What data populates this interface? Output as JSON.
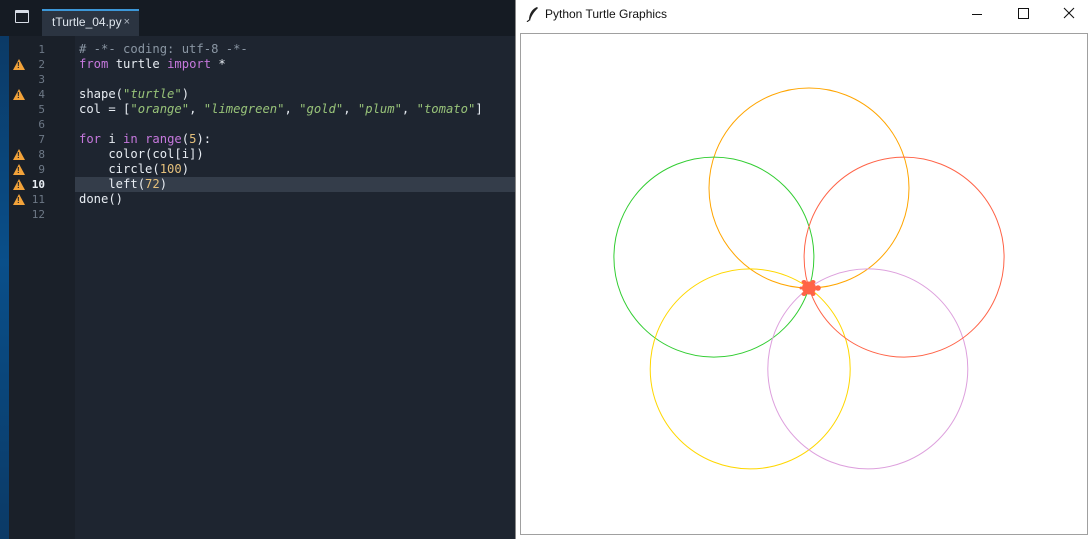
{
  "editor": {
    "tab": {
      "label": "tTurtle_04.py",
      "close": "×"
    },
    "active_line": 10,
    "lines": [
      {
        "num": "1",
        "warn": false,
        "tokens": [
          {
            "t": "# -*- coding: utf-8 -*-",
            "c": "comment"
          }
        ]
      },
      {
        "num": "2",
        "warn": true,
        "tokens": [
          {
            "t": "from",
            "c": "kw"
          },
          {
            "t": " turtle ",
            "c": "def"
          },
          {
            "t": "import",
            "c": "kw"
          },
          {
            "t": " *",
            "c": "def"
          }
        ]
      },
      {
        "num": "3",
        "warn": false,
        "tokens": []
      },
      {
        "num": "4",
        "warn": true,
        "tokens": [
          {
            "t": "shape(",
            "c": "def"
          },
          {
            "t": "\"turtle\"",
            "c": "str"
          },
          {
            "t": ")",
            "c": "def"
          }
        ]
      },
      {
        "num": "5",
        "warn": false,
        "tokens": [
          {
            "t": "col = [",
            "c": "def"
          },
          {
            "t": "\"orange\"",
            "c": "str"
          },
          {
            "t": ", ",
            "c": "def"
          },
          {
            "t": "\"limegreen\"",
            "c": "str"
          },
          {
            "t": ", ",
            "c": "def"
          },
          {
            "t": "\"gold\"",
            "c": "str"
          },
          {
            "t": ", ",
            "c": "def"
          },
          {
            "t": "\"plum\"",
            "c": "str"
          },
          {
            "t": ", ",
            "c": "def"
          },
          {
            "t": "\"tomato\"",
            "c": "str"
          },
          {
            "t": "]",
            "c": "def"
          }
        ]
      },
      {
        "num": "6",
        "warn": false,
        "tokens": []
      },
      {
        "num": "7",
        "warn": false,
        "tokens": [
          {
            "t": "for",
            "c": "kw"
          },
          {
            "t": " i ",
            "c": "def"
          },
          {
            "t": "in",
            "c": "kw"
          },
          {
            "t": " ",
            "c": "def"
          },
          {
            "t": "range",
            "c": "kw"
          },
          {
            "t": "(",
            "c": "def"
          },
          {
            "t": "5",
            "c": "num"
          },
          {
            "t": "):",
            "c": "def"
          }
        ]
      },
      {
        "num": "8",
        "warn": true,
        "tokens": [
          {
            "t": "    color(col[i])",
            "c": "def"
          }
        ]
      },
      {
        "num": "9",
        "warn": true,
        "tokens": [
          {
            "t": "    circle(",
            "c": "def"
          },
          {
            "t": "100",
            "c": "num"
          },
          {
            "t": ")",
            "c": "def"
          }
        ]
      },
      {
        "num": "10",
        "warn": true,
        "tokens": [
          {
            "t": "    left(",
            "c": "def"
          },
          {
            "t": "72",
            "c": "num"
          },
          {
            "t": ")",
            "c": "def"
          }
        ]
      },
      {
        "num": "11",
        "warn": true,
        "tokens": [
          {
            "t": "done()",
            "c": "def"
          }
        ]
      },
      {
        "num": "12",
        "warn": false,
        "tokens": []
      }
    ],
    "colors": {
      "comment": "#8a96a3",
      "kw": "#c678dd",
      "str": "#98c379",
      "num": "#e5c07b",
      "def": "#e7ecf2",
      "warn": "#f3a33a"
    }
  },
  "turtle_window": {
    "title": "Python Turtle Graphics",
    "buttons": {
      "minimize": "minimize-icon",
      "maximize": "maximize-icon",
      "close": "close-icon"
    },
    "drawing": {
      "radius": 100,
      "turn_degrees": 72,
      "circles": [
        {
          "color": "orange",
          "hex": "#ffa500"
        },
        {
          "color": "limegreen",
          "hex": "#32cd32"
        },
        {
          "color": "gold",
          "hex": "#ffd700"
        },
        {
          "color": "plum",
          "hex": "#dda0dd"
        },
        {
          "color": "tomato",
          "hex": "#ff6347"
        }
      ],
      "turtle_shape": "turtle",
      "turtle_color": "#ff6347"
    }
  }
}
